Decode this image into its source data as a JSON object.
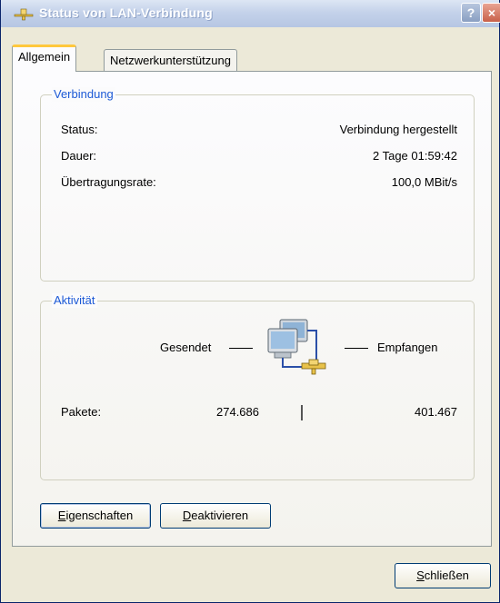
{
  "window": {
    "title": "Status von LAN-Verbindung",
    "help_label": "?",
    "close_label": "×"
  },
  "tabs": [
    {
      "label": "Allgemein"
    },
    {
      "label": "Netzwerkunterstützung"
    }
  ],
  "connection": {
    "title": "Verbindung",
    "rows": [
      {
        "label": "Status:",
        "value": "Verbindung hergestellt"
      },
      {
        "label": "Dauer:",
        "value": "2 Tage 01:59:42"
      },
      {
        "label": "Übertragungsrate:",
        "value": "100,0 MBit/s"
      }
    ]
  },
  "activity": {
    "title": "Aktivität",
    "sent_label": "Gesendet",
    "received_label": "Empfangen",
    "packets_label": "Pakete:",
    "packets_sent": "274.686",
    "packets_received": "401.467"
  },
  "buttons": {
    "properties": {
      "accel": "E",
      "rest": "igenschaften"
    },
    "deactivate": {
      "accel": "D",
      "rest": "eaktivieren"
    },
    "close": {
      "accel": "S",
      "rest": "chließen"
    }
  }
}
